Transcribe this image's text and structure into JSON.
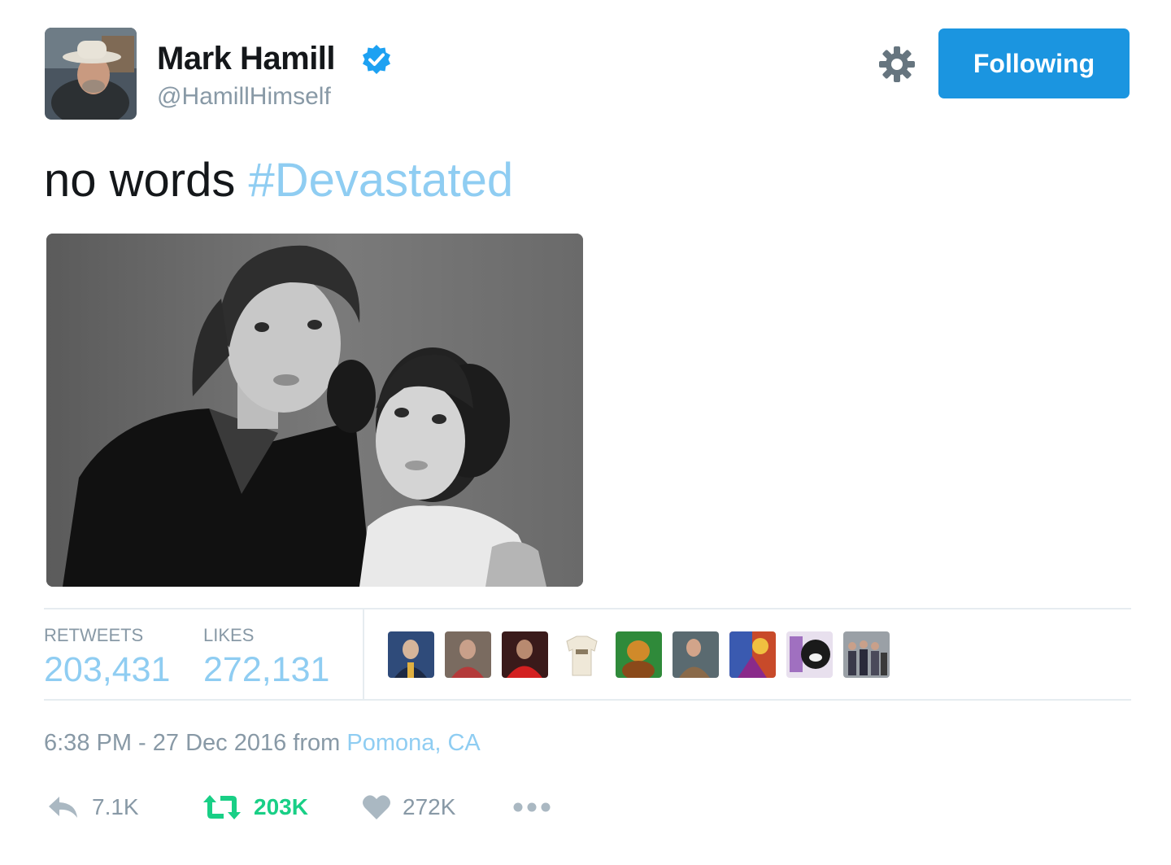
{
  "profile": {
    "name": "Mark Hamill",
    "handle": "@HamillHimself"
  },
  "header": {
    "settings_icon": "gear-icon",
    "follow_button_label": "Following"
  },
  "tweet": {
    "text": "no words",
    "hashtag": "#Devastated"
  },
  "stats": {
    "retweets_label": "RETWEETS",
    "retweets_value": "203,431",
    "likes_label": "LIKES",
    "likes_value": "272,131"
  },
  "meta": {
    "time_date": "6:38 PM - 27 Dec 2016",
    "from_text": "from",
    "location": "Pomona, CA"
  },
  "actions": {
    "reply_count": "7.1K",
    "retweet_count": "203K",
    "like_count": "272K"
  },
  "colors": {
    "accent": "#1b95e0",
    "link": "#8fcdf2",
    "retweet_green": "#19cf86",
    "muted": "#8899a6",
    "verified": "#1da1f2"
  }
}
